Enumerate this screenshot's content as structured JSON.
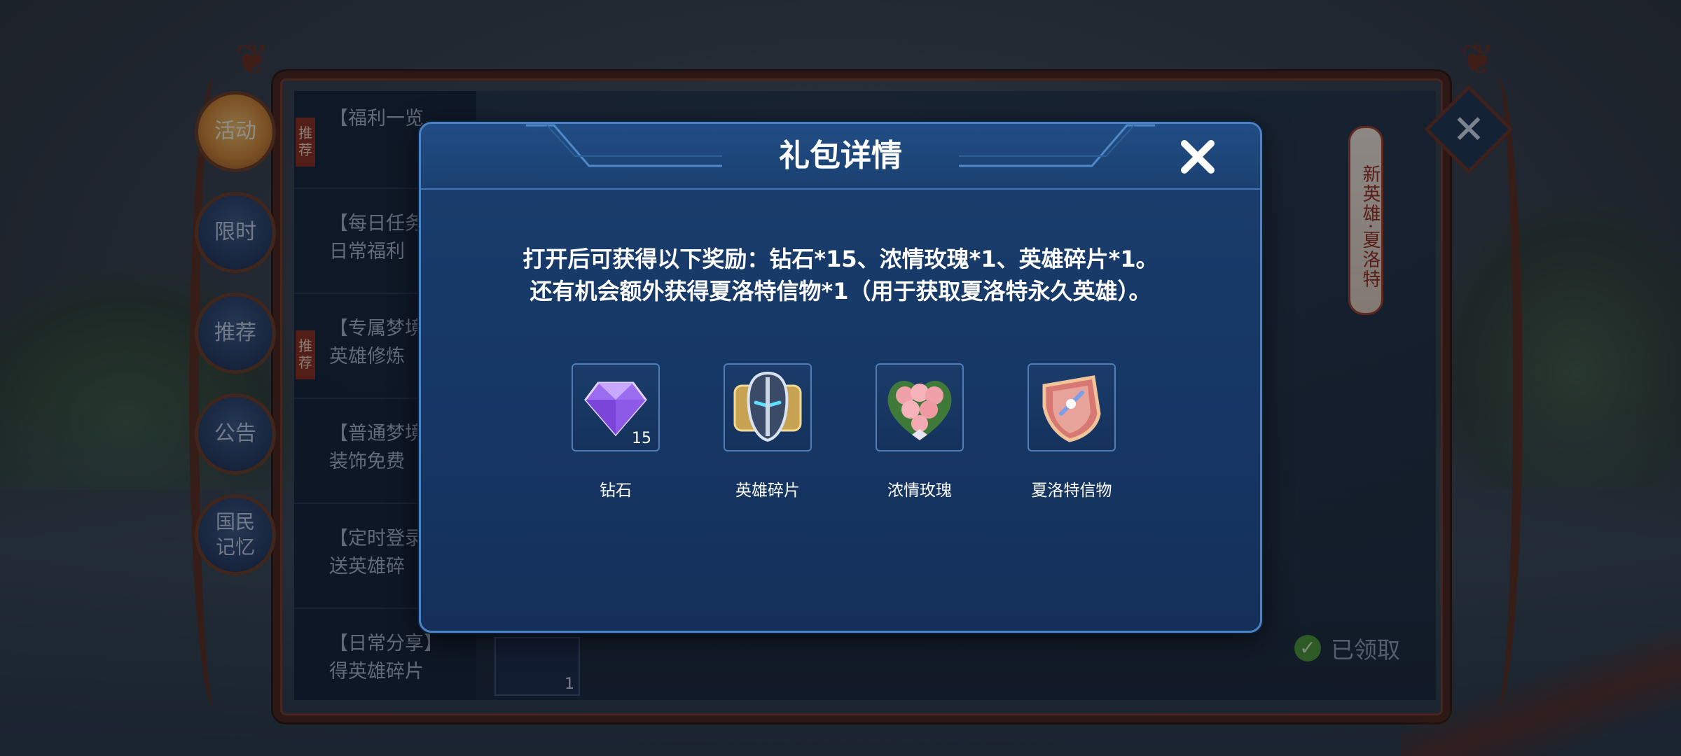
{
  "side_tabs": [
    {
      "label": "活动",
      "active": true
    },
    {
      "label": "限时",
      "active": false
    },
    {
      "label": "推荐",
      "active": false
    },
    {
      "label": "公告",
      "active": false
    },
    {
      "label": "国民记忆",
      "active": false
    }
  ],
  "activity_list": [
    {
      "line1": "【福利一览",
      "line2": "",
      "tag": "推荐"
    },
    {
      "line1": "【每日任务",
      "line2": "日常福利",
      "tag": ""
    },
    {
      "line1": "【专属梦境",
      "line2": "英雄修炼",
      "tag": "推荐"
    },
    {
      "line1": "【普通梦境",
      "line2": "装饰免费",
      "tag": ""
    },
    {
      "line1": "【定时登录",
      "line2": "送英雄碎",
      "tag": ""
    },
    {
      "line1": "【日常分享】",
      "line2": "得英雄碎片",
      "tag": ""
    }
  ],
  "hero_banner": "新英雄·夏洛特",
  "background_item_count": "1",
  "claimed_status": "已领取",
  "modal": {
    "title": "礼包详情",
    "description_line1": "打开后可获得以下奖励：钻石*15、浓情玫瑰*1、英雄碎片*1。",
    "description_line2": "还有机会额外获得夏洛特信物*1（用于获取夏洛特永久英雄）。",
    "rewards": [
      {
        "name": "钻石",
        "count": "15",
        "icon": "diamond-icon"
      },
      {
        "name": "英雄碎片",
        "count": "",
        "icon": "hero-fragment-icon"
      },
      {
        "name": "浓情玫瑰",
        "count": "",
        "icon": "rose-bouquet-icon"
      },
      {
        "name": "夏洛特信物",
        "count": "",
        "icon": "charlotte-token-icon"
      }
    ]
  },
  "colors": {
    "modal_bg": "#163765",
    "modal_border": "#4d82c2",
    "frame_wood": "#4a2216",
    "active_tab": "#d98a33",
    "claimed_check": "#4c9a35"
  }
}
